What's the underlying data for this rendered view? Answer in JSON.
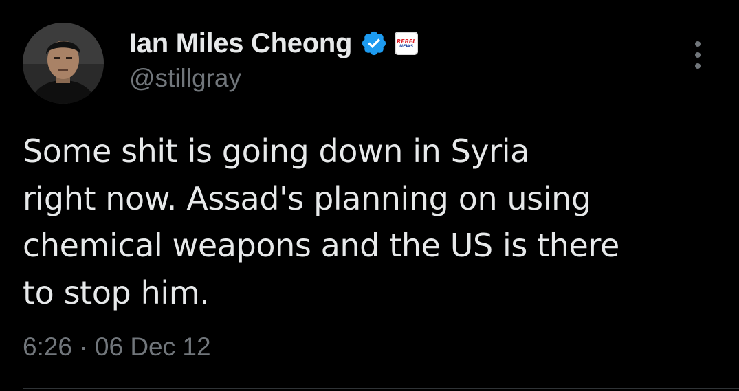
{
  "author": {
    "display_name": "Ian Miles Cheong",
    "handle": "@stillgray",
    "verified_icon": "verified-badge-icon",
    "affiliate_icon": "rebel-news-affiliate-icon",
    "affiliate_text_1": "REBEL",
    "affiliate_text_2": "NEWS"
  },
  "tweet": {
    "lines": [
      "Some shit is going down in Syria",
      "right now. Assad's planning on using",
      "chemical weapons and the US is there",
      "to stop him."
    ],
    "timestamp": "6:26 · 06 Dec 12"
  },
  "colors": {
    "background": "#000000",
    "primary_text": "#e7e9ea",
    "secondary_text": "#71767b",
    "verified_blue": "#1d9bf0"
  }
}
